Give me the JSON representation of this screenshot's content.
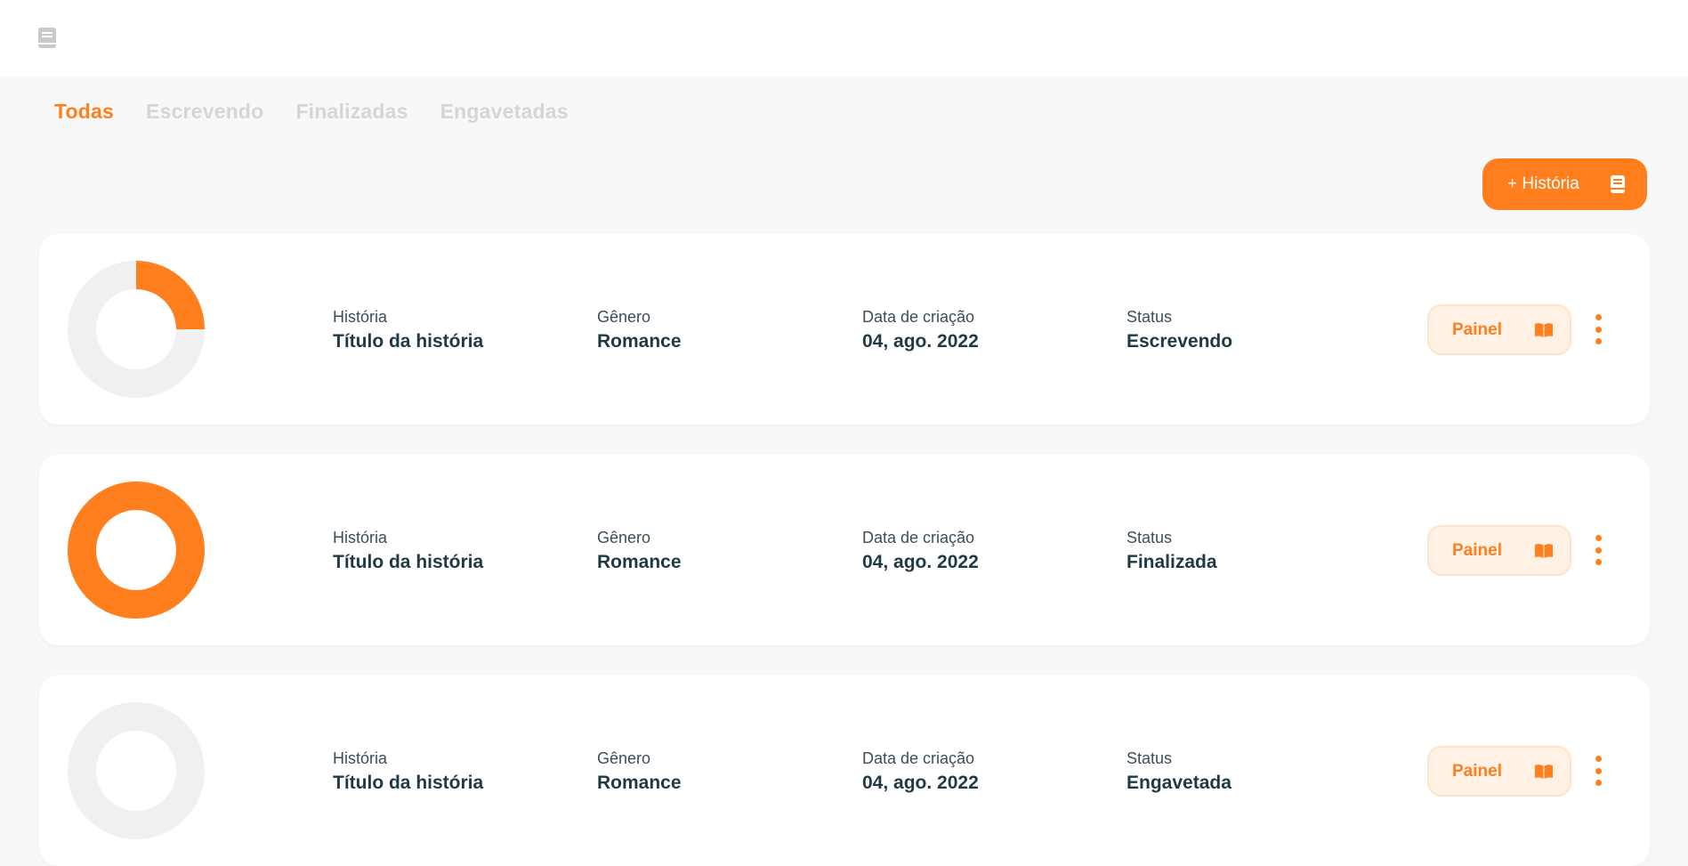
{
  "header": {
    "logo_icon": "book-icon"
  },
  "tabs": [
    {
      "label": "Todas",
      "active": true
    },
    {
      "label": "Escrevendo",
      "active": false
    },
    {
      "label": "Finalizadas",
      "active": false
    },
    {
      "label": "Engavetadas",
      "active": false
    }
  ],
  "add_button": {
    "label": "+ História",
    "icon": "book-icon"
  },
  "colors": {
    "accent": "#ff7f1e",
    "track": "#f0f0f0",
    "panel_bg": "#fff1e3"
  },
  "labels": {
    "story": "História",
    "genre": "Gênero",
    "created": "Data de criação",
    "status": "Status"
  },
  "stories": [
    {
      "title": "Título da história",
      "genre": "Romance",
      "date": "04, ago. 2022",
      "status": "Escrevendo",
      "progress": 0.25,
      "panel_label": "Painel"
    },
    {
      "title": "Título da história",
      "genre": "Romance",
      "date": "04, ago. 2022",
      "status": "Finalizada",
      "progress": 1.0,
      "panel_label": "Painel"
    },
    {
      "title": "Título da história",
      "genre": "Romance",
      "date": "04, ago. 2022",
      "status": "Engavetada",
      "progress": 0.0,
      "panel_label": "Painel"
    }
  ]
}
